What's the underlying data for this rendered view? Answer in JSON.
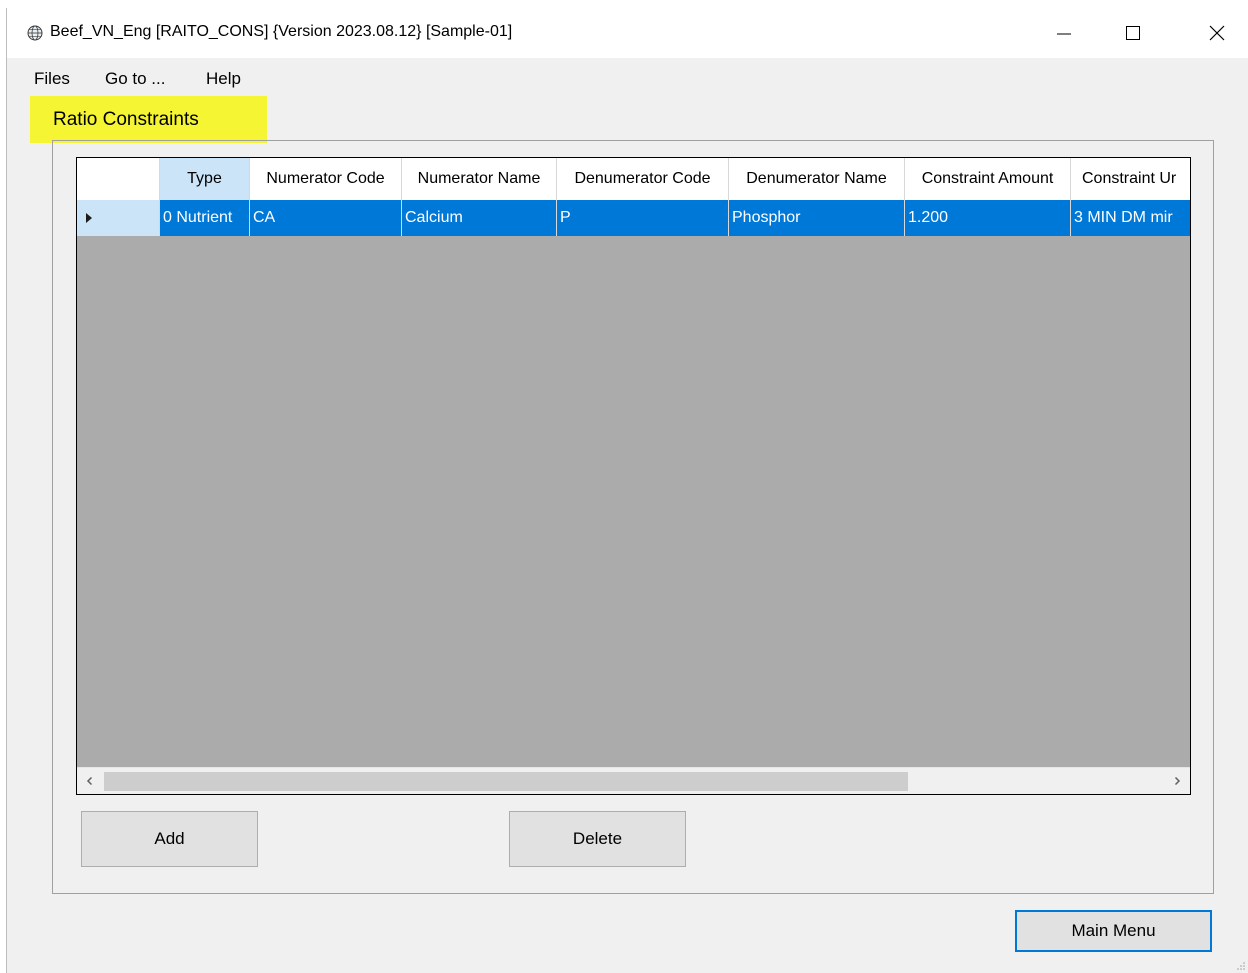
{
  "window": {
    "title": "Beef_VN_Eng [RAITO_CONS] {Version 2023.08.12}  [Sample-01]",
    "icon": "globe-app-icon"
  },
  "title_buttons": {
    "minimize": "minimize-icon",
    "maximize": "maximize-icon",
    "close": "close-icon"
  },
  "menu": {
    "files": "Files",
    "goto": "Go to ...",
    "help": "Help"
  },
  "section_title": "Ratio Constraints",
  "grid": {
    "columns": [
      "Type",
      "Numerator Code",
      "Numerator Name",
      "Denumerator Code",
      "Denumerator Name",
      "Constraint Amount",
      "Constraint Ur"
    ],
    "rows": [
      {
        "cells": [
          "0 Nutrient",
          "CA",
          "Calcium",
          "P",
          "Phosphor",
          "1.200",
          "3 MIN DM mir"
        ]
      }
    ]
  },
  "buttons": {
    "add": "Add",
    "delete": "Delete",
    "main_menu": "Main Menu"
  },
  "colors": {
    "selection": "#0078d7",
    "highlight": "#f5f533",
    "grid_background": "#ababab"
  }
}
